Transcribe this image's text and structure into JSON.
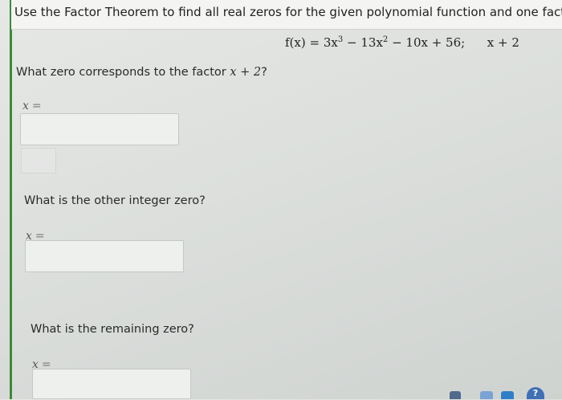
{
  "instruction": "Use the Factor Theorem to find all real zeros for the given polynomial function and one factor.",
  "formula": {
    "lhs": "f(x) =",
    "term1": "3x",
    "exp1": "3",
    "term2": "− 13x",
    "exp2": "2",
    "term3": "− 10x + 56;",
    "factor": "x + 2"
  },
  "questions": [
    {
      "text": "What zero corresponds to the factor ",
      "math": "x + 2",
      "suffix": "?",
      "var": "x",
      "eq": "=",
      "value": ""
    },
    {
      "text": "What is the other integer zero?",
      "var": "x",
      "eq": "=",
      "value": ""
    },
    {
      "text": "What is the remaining zero?",
      "var": "x",
      "eq": "=",
      "value": ""
    }
  ],
  "colors": {
    "accent_rule": "#3a8a3a",
    "help_icon": "#3f6fb5"
  }
}
